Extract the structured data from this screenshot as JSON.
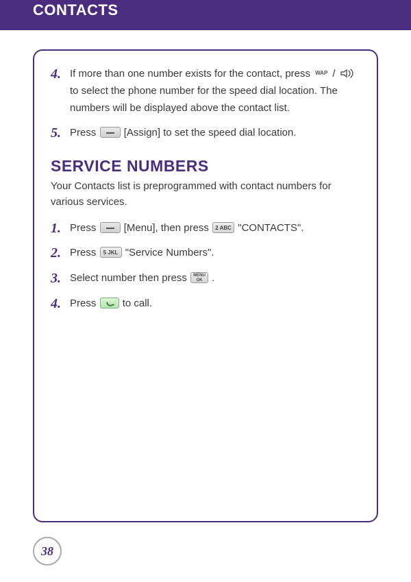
{
  "header": {
    "title": "CONTACTS"
  },
  "top_steps": [
    {
      "n": "4.",
      "pre": "If more than one number exists for the contact, press ",
      "sep": " / ",
      "post": " to select the phone number for the speed dial location.  The numbers will be displayed above the contact list."
    },
    {
      "n": "5.",
      "pre": "Press ",
      "post": " [Assign] to set the speed dial location."
    }
  ],
  "section": {
    "heading": "SERVICE NUMBERS",
    "lead": "Your Contacts list is preprogrammed with contact numbers for various services."
  },
  "steps": [
    {
      "n": "1.",
      "a": "Press ",
      "b": " [Menu], then press ",
      "c": " \"CONTACTS\"."
    },
    {
      "n": "2.",
      "a": "Press ",
      "b": " \"Service Numbers\"."
    },
    {
      "n": "3.",
      "a": "Select number then press ",
      "b": " ."
    },
    {
      "n": "4.",
      "a": "Press ",
      "b": " to call."
    }
  ],
  "keys": {
    "wap": "WAP",
    "abc": "2 ABC",
    "jkl": "5 JKL",
    "menuok": "MENU\nOK"
  },
  "page_number": "38"
}
